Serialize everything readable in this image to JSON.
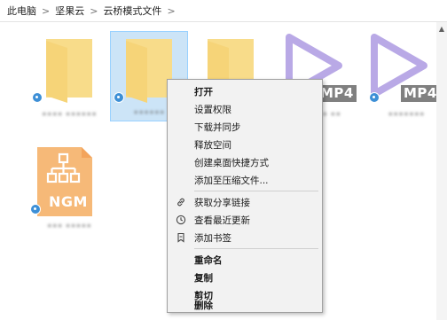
{
  "breadcrumb": {
    "items": [
      "此电脑",
      "坚果云",
      "云桥模式文件"
    ],
    "separator": ">"
  },
  "files": [
    {
      "name": "•••• ••••••",
      "type": "folder"
    },
    {
      "name": "••••••",
      "type": "folder",
      "selected": true
    },
    {
      "name": "•••• ••",
      "type": "folder"
    },
    {
      "name": "••••• ••",
      "type": "mp4",
      "badge": "MP4"
    },
    {
      "name": "•••••••",
      "type": "mp4",
      "badge": "MP4"
    },
    {
      "name": "••• •••••",
      "type": "ngm",
      "badge": "NGM"
    }
  ],
  "context_menu": {
    "group1": [
      "打开",
      "设置权限",
      "下载并同步",
      "释放空间",
      "创建桌面快捷方式",
      "添加至压缩文件..."
    ],
    "group2": [
      "获取分享链接",
      "查看最近更新",
      "添加书签"
    ],
    "group3": [
      "重命名",
      "复制",
      "剪切",
      "删除"
    ]
  },
  "colors": {
    "folder": "#f8dc8a",
    "folder_dark": "#f1c75a",
    "mp4_play": "#b9a9e6",
    "ngm": "#f6b978",
    "selection": "#cce4f7",
    "sync_badge": "#3d8fd6"
  }
}
